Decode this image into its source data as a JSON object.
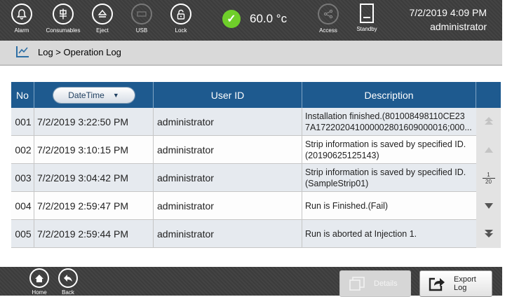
{
  "topbar": {
    "items": [
      {
        "label": "Alarm",
        "icon": "bell-icon"
      },
      {
        "label": "Consumables",
        "icon": "consumables-icon"
      },
      {
        "label": "Eject",
        "icon": "eject-icon"
      },
      {
        "label": "USB",
        "icon": "usb-icon"
      },
      {
        "label": "Lock",
        "icon": "lock-icon"
      },
      {
        "label": "Access",
        "icon": "access-share-icon"
      },
      {
        "label": "Standby",
        "icon": "standby-icon"
      }
    ],
    "temperature": "60.0 °c",
    "datetime": "7/2/2019 4:09 PM",
    "user": "administrator"
  },
  "breadcrumb": "Log > Operation Log",
  "table": {
    "headers": {
      "no": "No",
      "datetime": "DateTime",
      "user": "User ID",
      "description": "Description"
    },
    "rows": [
      {
        "no": "001",
        "datetime": "7/2/2019 3:22:50 PM",
        "user": "administrator",
        "description": "Installation finished.(801008498110CE23 7A172202041000002801609000016;000..."
      },
      {
        "no": "002",
        "datetime": "7/2/2019 3:10:15 PM",
        "user": "administrator",
        "description": "Strip information is saved by specified ID.(20190625125143)"
      },
      {
        "no": "003",
        "datetime": "7/2/2019 3:04:42 PM",
        "user": "administrator",
        "description": "Strip information is saved by specified ID.(SampleStrip01)"
      },
      {
        "no": "004",
        "datetime": "7/2/2019 2:59:47 PM",
        "user": "administrator",
        "description": "Run is Finished.(Fail)"
      },
      {
        "no": "005",
        "datetime": "7/2/2019 2:59:44 PM",
        "user": "administrator",
        "description": "Run is aborted at Injection 1."
      }
    ]
  },
  "pager": {
    "current": "1",
    "total": "20"
  },
  "bottombar": {
    "home_label": "Home",
    "back_label": "Back",
    "details_label": "Details",
    "export_label": "Export Log"
  },
  "colors": {
    "header_blue": "#1e5a8f",
    "ok_green": "#6fcf2a",
    "bar_dark": "#404040"
  }
}
